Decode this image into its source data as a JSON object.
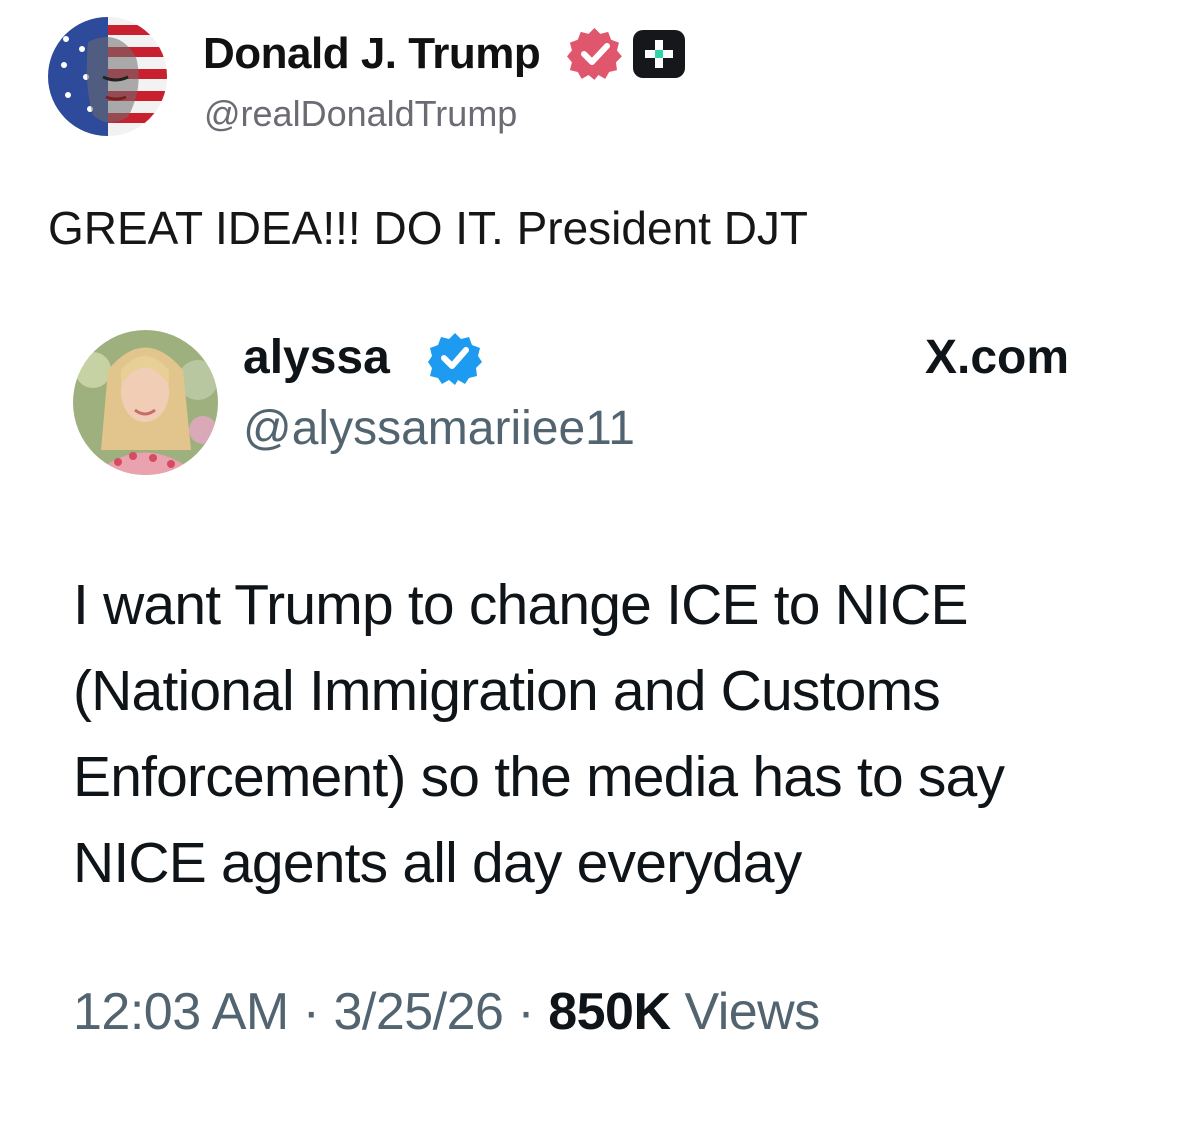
{
  "post": {
    "author_name": "Donald J. Trump",
    "author_handle": "@realDonaldTrump",
    "text": "GREAT IDEA!!! DO IT. President DJT"
  },
  "quote": {
    "author_name": "alyssa",
    "author_handle": "@alyssamariiee11",
    "source": "X.com",
    "lines": [
      "I want Trump to change ICE to NICE",
      "(National Immigration and Customs",
      "Enforcement) so the media has to say",
      "NICE agents all day everyday"
    ],
    "time": "12:03 AM",
    "separator": "·",
    "date": "3/25/26",
    "views_count": "850K",
    "views_label": "Views"
  },
  "colors": {
    "verified_pink": "#e0566d",
    "verified_blue": "#1d9bf0",
    "plus_badge": "#16171b",
    "plus_accent": "#2fd5a6"
  }
}
